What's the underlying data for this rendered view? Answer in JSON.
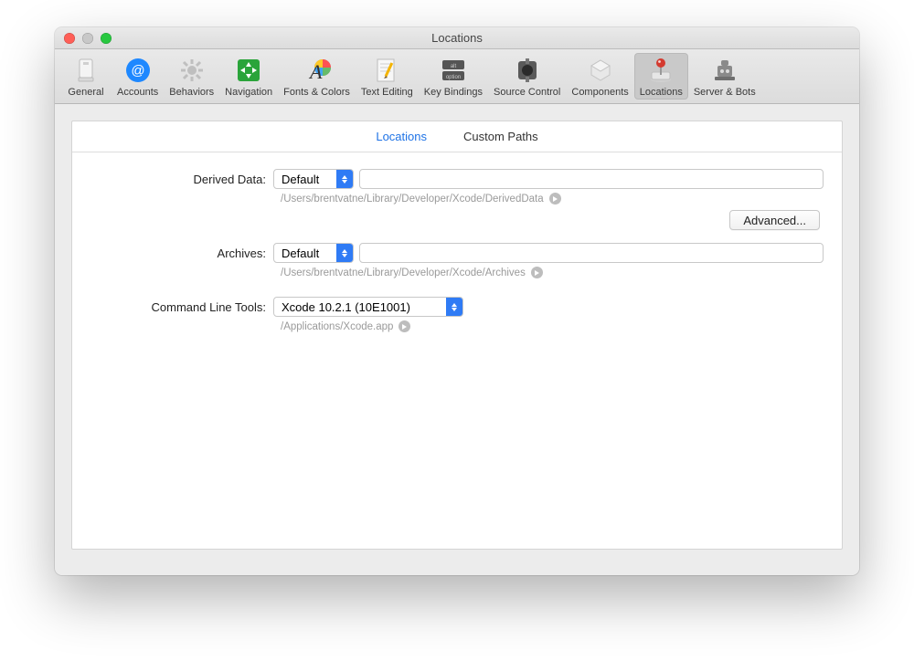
{
  "window": {
    "title": "Locations"
  },
  "toolbar": {
    "items": [
      {
        "label": "General"
      },
      {
        "label": "Accounts"
      },
      {
        "label": "Behaviors"
      },
      {
        "label": "Navigation"
      },
      {
        "label": "Fonts & Colors"
      },
      {
        "label": "Text Editing"
      },
      {
        "label": "Key Bindings"
      },
      {
        "label": "Source Control"
      },
      {
        "label": "Components"
      },
      {
        "label": "Locations"
      },
      {
        "label": "Server & Bots"
      }
    ]
  },
  "subtabs": {
    "locations": "Locations",
    "custom_paths": "Custom Paths"
  },
  "form": {
    "derived_data": {
      "label": "Derived Data:",
      "value": "Default",
      "path": "/Users/brentvatne/Library/Developer/Xcode/DerivedData",
      "advanced": "Advanced..."
    },
    "archives": {
      "label": "Archives:",
      "value": "Default",
      "path": "/Users/brentvatne/Library/Developer/Xcode/Archives"
    },
    "clt": {
      "label": "Command Line Tools:",
      "value": "Xcode 10.2.1 (10E1001)",
      "path": "/Applications/Xcode.app"
    }
  }
}
